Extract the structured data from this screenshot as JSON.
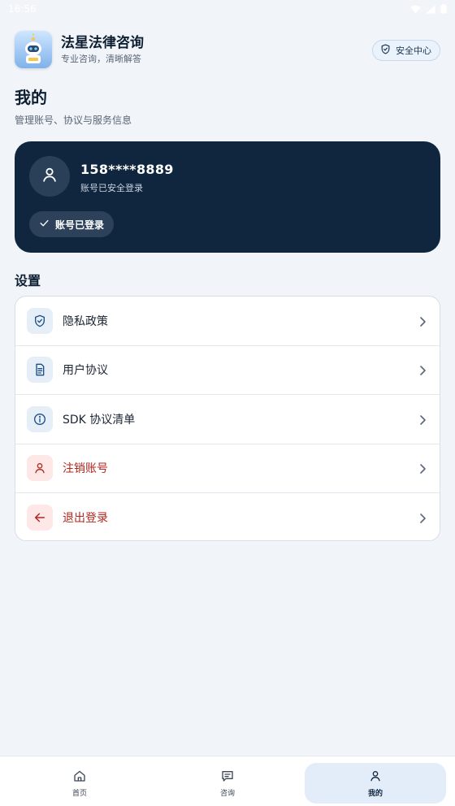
{
  "status_bar": {
    "time": "16:56",
    "icons": [
      "wifi-icon",
      "signal-icon",
      "battery-icon"
    ]
  },
  "header": {
    "app_name": "法星法律咨询",
    "app_tagline": "专业咨询，清晰解答",
    "security_button": "安全中心"
  },
  "page": {
    "title": "我的",
    "subtitle": "管理账号、协议与服务信息"
  },
  "account": {
    "phone": "158****8889",
    "status_text": "账号已安全登录",
    "login_chip": "账号已登录"
  },
  "settings": {
    "title": "设置",
    "items": [
      {
        "label": "隐私政策",
        "icon": "shield-icon",
        "tone": "normal"
      },
      {
        "label": "用户协议",
        "icon": "document-icon",
        "tone": "normal"
      },
      {
        "label": "SDK 协议清单",
        "icon": "info-icon",
        "tone": "normal"
      },
      {
        "label": "注销账号",
        "icon": "user-icon",
        "tone": "danger"
      },
      {
        "label": "退出登录",
        "icon": "arrow-left-icon",
        "tone": "danger"
      }
    ]
  },
  "bottom_nav": {
    "tabs": [
      {
        "label": "首页",
        "icon": "home-icon",
        "active": false
      },
      {
        "label": "咨询",
        "icon": "chat-icon",
        "active": false
      },
      {
        "label": "我的",
        "icon": "user-icon",
        "active": true
      }
    ]
  },
  "colors": {
    "background": "#f1f5f9",
    "card_dark": "#10263f",
    "danger": "#b3261e",
    "accent_blue": "#1c4f86"
  }
}
